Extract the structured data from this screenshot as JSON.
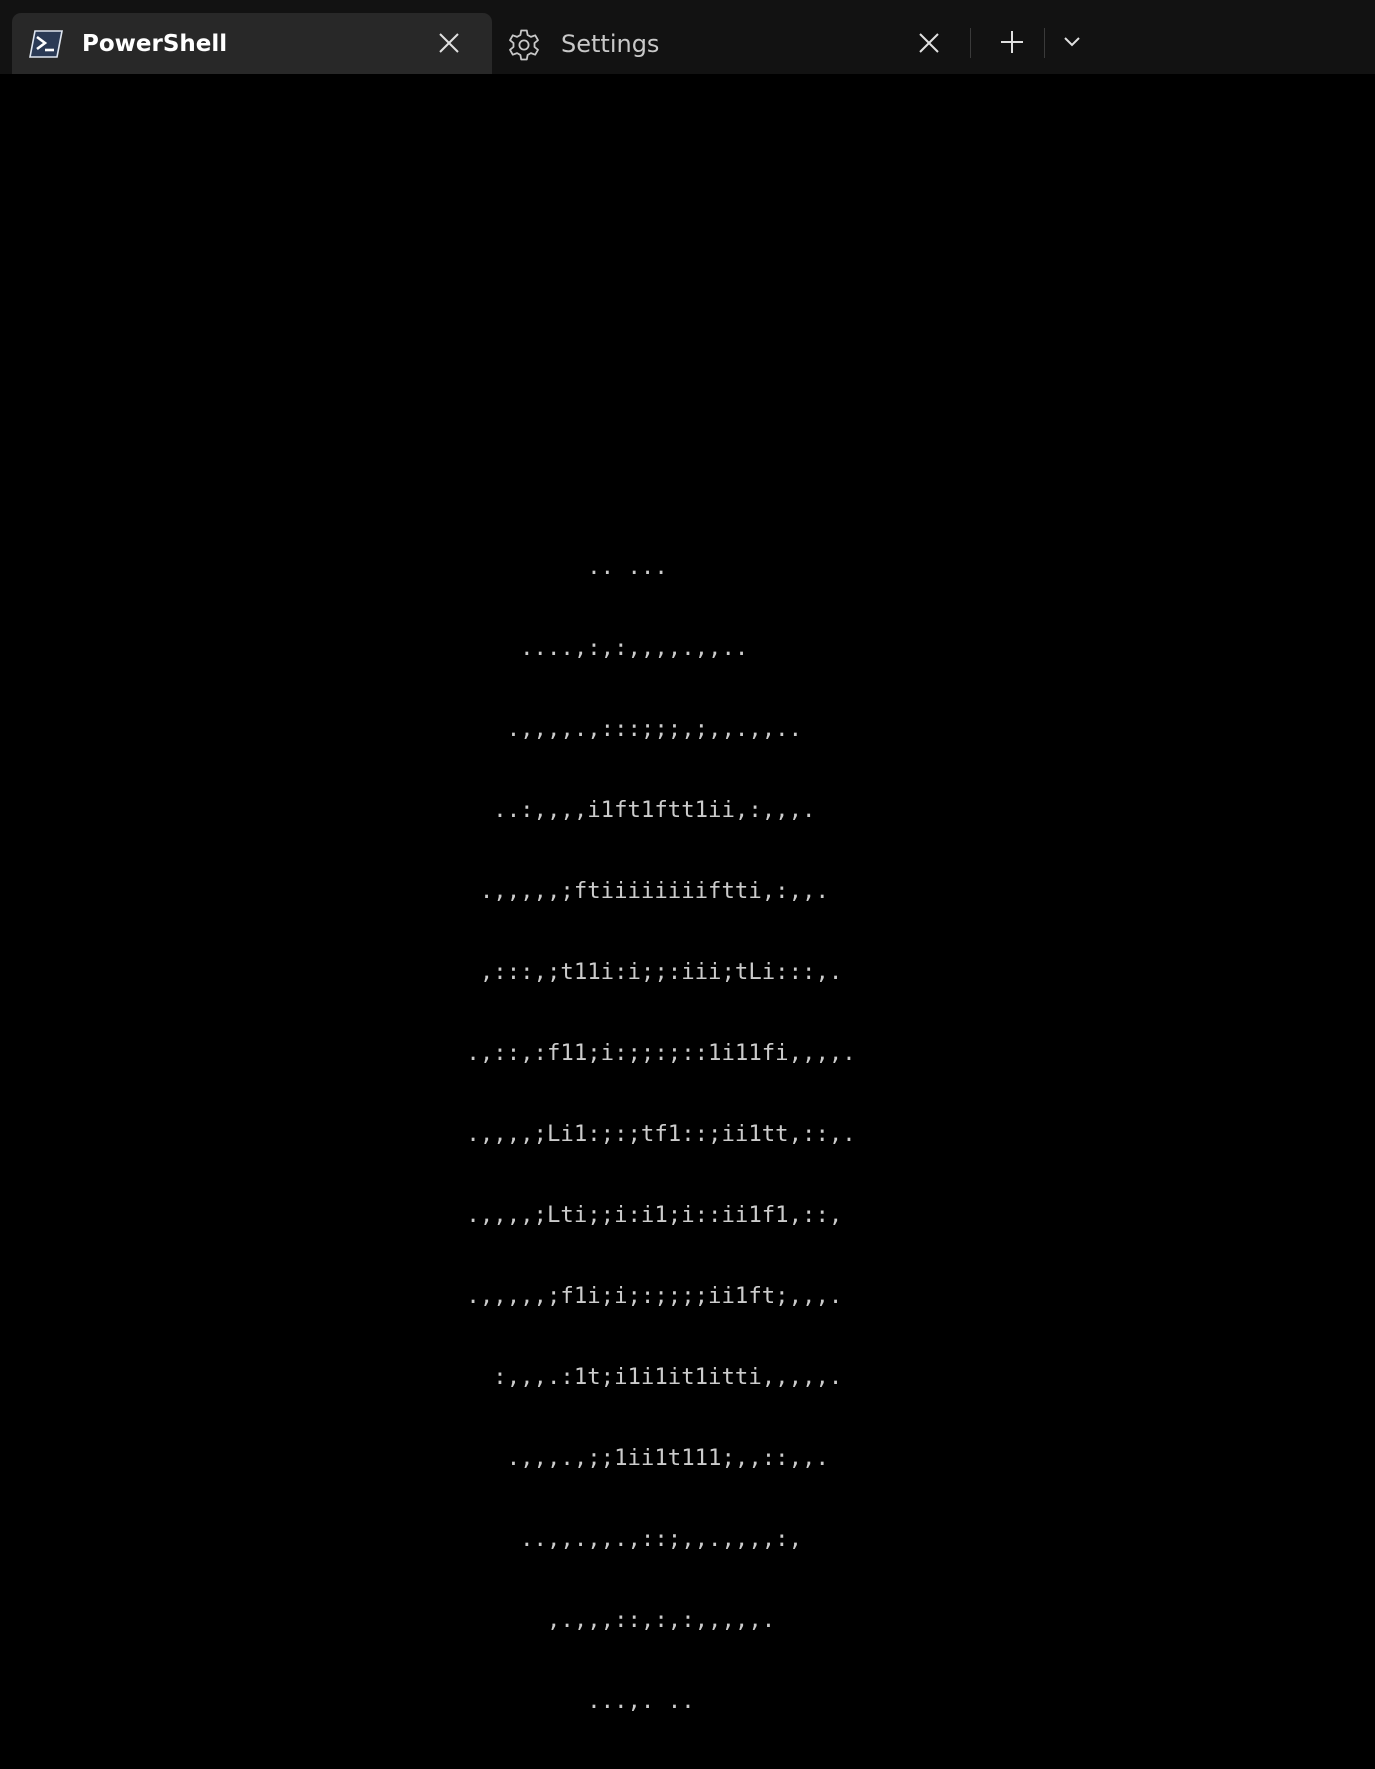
{
  "tabs": {
    "active": {
      "label": "PowerShell",
      "icon": "powershell-icon"
    },
    "settings": {
      "label": "Settings",
      "icon": "gear-icon"
    }
  },
  "toolbar": {
    "new_tab_icon": "plus-icon",
    "dropdown_icon": "chevron-down-icon"
  },
  "terminal": {
    "ascii_lines": [
      "          .. ...",
      "     ....,:,:,,,,.,,..",
      "    .,,,,.,:::;;;,;,,.,,..",
      "   ..:,,,,i1ft1ftt1ii,:,,,.",
      "  .,,,,,;ftiiiiiiiiftti,:,,.",
      "  ,:::,;t11i:i;;:iii;tLi:::,.",
      " .,::,:f11;i:;;:;::1i11fi,,,,.",
      " .,,,,;Li1:;:;tf1::;ii1tt,::,.",
      " .,,,,;Lti;;i:i1;i::ii1f1,::,",
      " .,,,,,;f1i;i;:;;;;ii1ft;,,,.",
      "   :,,,.:1t;i1i1it1itti,,,,,.",
      "    .,,,.,;;1ii1t111;,,::,,.",
      "     ..,,.,,.,::;,,.,,,,:,",
      "       ,.,,,::,:,:,,,,,.",
      "          ...,. .."
    ]
  },
  "colors": {
    "titlebar": "#121212",
    "active_tab": "#282828",
    "terminal_bg": "#000000",
    "terminal_fg": "#cccccc"
  }
}
